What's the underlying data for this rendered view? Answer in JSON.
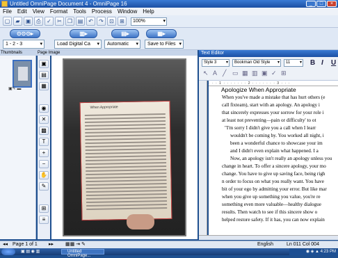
{
  "window": {
    "title": "Untitled OmniPage Document 4 - OmniPage 16"
  },
  "menu": [
    "File",
    "Edit",
    "View",
    "Format",
    "Tools",
    "Process",
    "Window",
    "Help"
  ],
  "toolbar": {
    "zoom": "100%"
  },
  "workflow": {
    "pages": "1 - 2 - 3",
    "source": "Load Digital Ca",
    "layout": "Automatic",
    "output": "Save to Files"
  },
  "panes": {
    "thumbnails": "Thumbnails",
    "page_image": "Page Image",
    "text_editor": "Text Editor"
  },
  "text_editor": {
    "style": "Style 3",
    "font": "Bookman Old Style",
    "size": "11",
    "ruler": "· · · 1 · · · · · · · 2 · · · · · · · 3 · · ·",
    "title": "Apologize When Appropriate",
    "lines": [
      "When you've made a mistake that has hurt others (e",
      "call fixteam), start with an apology. An apology i",
      "that sincerely expresses your sorrow for your role i",
      "at least not preventing—pain or difficulty' to ot",
      "\"I'm sorry I didn't give you a call when I learr",
      "wouldn't be coming by. You worked all night, i",
      "been a wonderful chance to showcase your im",
      "and I didn't even explain what happened. I a",
      "Now, an apology isn't really an apology unless you",
      "change in heart. To offer a sincere apology, your mo",
      "change. You have to give up saving face, being righ",
      "n order to focus on what you really want. You have",
      "bit of your ego by admitting your error. But like mar",
      "when you give up something you value, you're re",
      "something even more valuable—healthy dialogue",
      "results. Then watch to see if this sincere show o",
      "helped restore safety. If it has, you can now explain"
    ]
  },
  "status": {
    "page": "Page 1 of 1",
    "language": "English",
    "position": "Ln 011 Col 004"
  },
  "taskbar": {
    "task": "Untitled OmniPage...",
    "clock": "4:23 PM"
  },
  "book_image": {
    "heading": "When Appropriate"
  }
}
